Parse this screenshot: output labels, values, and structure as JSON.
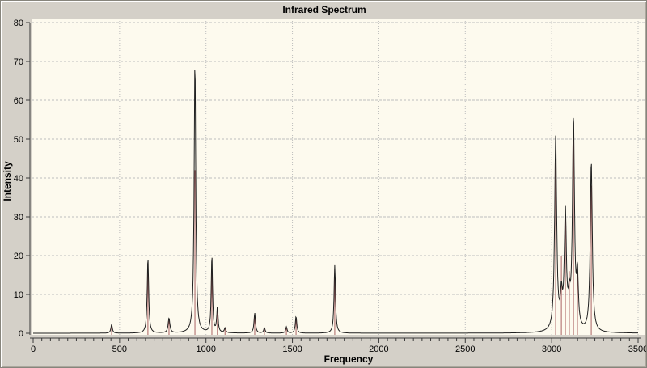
{
  "window": {
    "title": "Infrared Spectrum"
  },
  "chart_data": {
    "type": "line",
    "subtype": "ir-spectrum-with-impulse-sticks",
    "title": "Infrared Spectrum",
    "xlabel": "Frequency",
    "ylabel": "Intensity",
    "xlim": [
      0,
      3500
    ],
    "ylim": [
      0,
      80
    ],
    "x_tick_labels": [
      0,
      500,
      1000,
      1500,
      2000,
      2500,
      3000,
      3500
    ],
    "x_minor_tick_step": 50,
    "y_tick_labels": [
      0,
      10,
      20,
      30,
      40,
      50,
      60,
      70,
      80
    ],
    "grid": "dotted",
    "legend_position": "none",
    "colors": {
      "window_background": "#d4d0c8",
      "plot_background": "#fdfaee",
      "gridline": "#bdbdbd",
      "axis": "#3a3a3a",
      "curve": "#202020",
      "stick": "#aa6262",
      "text": "#000000"
    },
    "series": [
      {
        "name": "vibrational-mode-sticks",
        "type": "stick",
        "color": "#aa6262",
        "points": [
          {
            "frequency": 454,
            "intensity": 2.2
          },
          {
            "frequency": 664,
            "intensity": 18.0
          },
          {
            "frequency": 786,
            "intensity": 3.2
          },
          {
            "frequency": 936,
            "intensity": 42.0
          },
          {
            "frequency": 1034,
            "intensity": 17.5
          },
          {
            "frequency": 1066,
            "intensity": 6.5
          },
          {
            "frequency": 1110,
            "intensity": 1.5
          },
          {
            "frequency": 1282,
            "intensity": 4.5
          },
          {
            "frequency": 1338,
            "intensity": 1.2
          },
          {
            "frequency": 1465,
            "intensity": 1.3
          },
          {
            "frequency": 1521,
            "intensity": 3.5
          },
          {
            "frequency": 1745,
            "intensity": 16.5
          },
          {
            "frequency": 3023,
            "intensity": 44.0
          },
          {
            "frequency": 3056,
            "intensity": 20.0
          },
          {
            "frequency": 3079,
            "intensity": 32.5
          },
          {
            "frequency": 3102,
            "intensity": 16.0
          },
          {
            "frequency": 3126,
            "intensity": 50.0
          },
          {
            "frequency": 3149,
            "intensity": 17.0
          },
          {
            "frequency": 3229,
            "intensity": 38.0
          }
        ]
      },
      {
        "name": "broadened-spectrum-curve",
        "type": "lorentzian-sum",
        "color": "#202020",
        "peaks": [
          {
            "frequency": 454,
            "amplitude": 2.3,
            "gamma": 5
          },
          {
            "frequency": 664,
            "amplitude": 19.5,
            "gamma": 5
          },
          {
            "frequency": 786,
            "amplitude": 3.8,
            "gamma": 6
          },
          {
            "frequency": 936,
            "amplitude": 70.0,
            "gamma": 5.5
          },
          {
            "frequency": 1034,
            "amplitude": 20.0,
            "gamma": 4.5
          },
          {
            "frequency": 1066,
            "amplitude": 6.6,
            "gamma": 4.5
          },
          {
            "frequency": 1110,
            "amplitude": 1.2,
            "gamma": 5
          },
          {
            "frequency": 1282,
            "amplitude": 5.2,
            "gamma": 5
          },
          {
            "frequency": 1338,
            "amplitude": 1.4,
            "gamma": 5
          },
          {
            "frequency": 1465,
            "amplitude": 1.6,
            "gamma": 5
          },
          {
            "frequency": 1521,
            "amplitude": 4.3,
            "gamma": 5
          },
          {
            "frequency": 1745,
            "amplitude": 17.5,
            "gamma": 5
          },
          {
            "frequency": 3023,
            "amplitude": 50.0,
            "gamma": 7
          },
          {
            "frequency": 3056,
            "amplitude": 8.0,
            "gamma": 7
          },
          {
            "frequency": 3079,
            "amplitude": 30.0,
            "gamma": 7
          },
          {
            "frequency": 3102,
            "amplitude": 6.5,
            "gamma": 7
          },
          {
            "frequency": 3126,
            "amplitude": 54.0,
            "gamma": 7
          },
          {
            "frequency": 3149,
            "amplitude": 13.0,
            "gamma": 6
          },
          {
            "frequency": 3229,
            "amplitude": 44.0,
            "gamma": 7
          }
        ]
      }
    ]
  }
}
